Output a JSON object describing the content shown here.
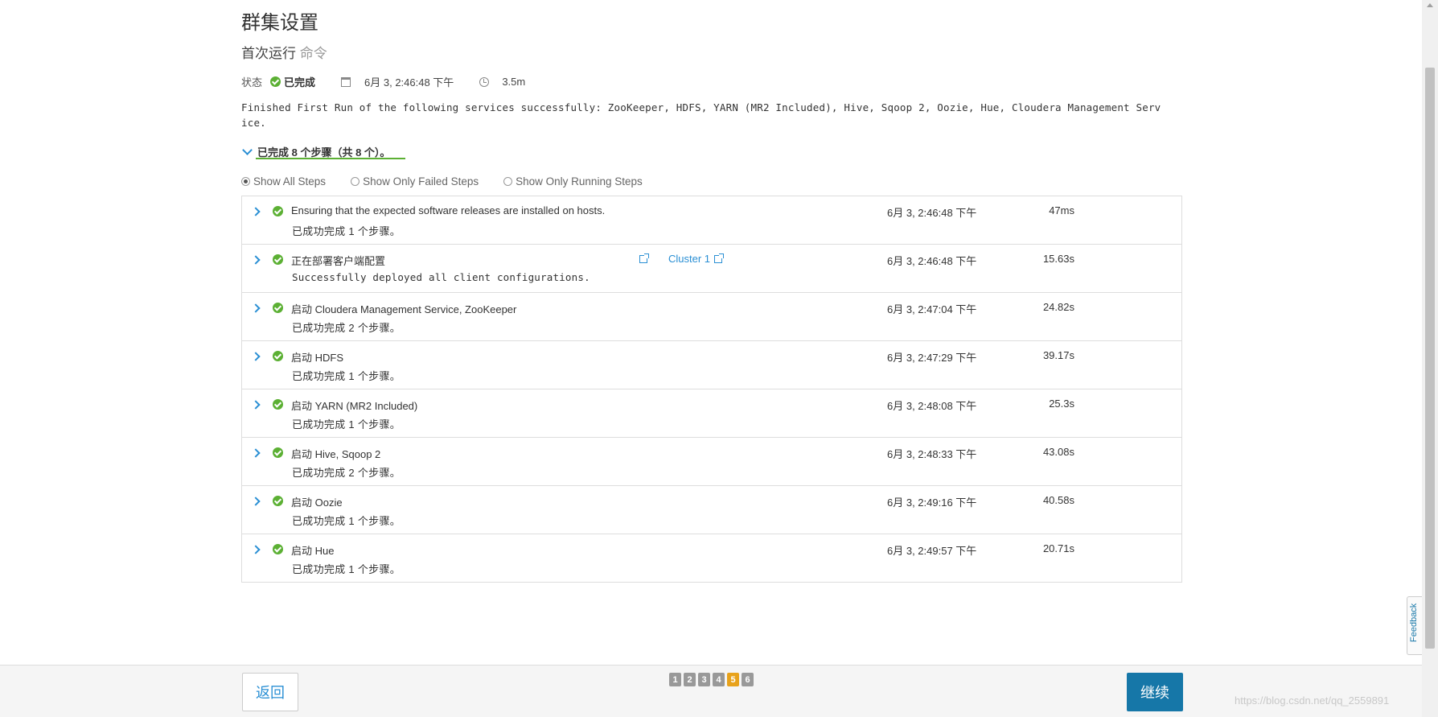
{
  "header": {
    "title": "群集设置",
    "subtitle_main": "首次运行",
    "subtitle_muted": "命令"
  },
  "status": {
    "label": "状态",
    "value": "已完成",
    "date": "6月 3, 2:46:48 下午",
    "duration": "3.5m"
  },
  "message": "Finished First Run of the following services successfully: ZooKeeper, HDFS, YARN (MR2 Included), Hive, Sqoop 2, Oozie, Hue, Cloudera Management Service.",
  "steps_summary": "已完成 8 个步骤（共 8 个）。",
  "filters": [
    {
      "label": "Show All Steps",
      "checked": true
    },
    {
      "label": "Show Only Failed Steps",
      "checked": false
    },
    {
      "label": "Show Only Running Steps",
      "checked": false
    }
  ],
  "steps": [
    {
      "name": "Ensuring that the expected software releases are installed on hosts.",
      "detail": "已成功完成 1 个步骤。",
      "time": "6月 3, 2:46:48 下午",
      "duration": "47ms"
    },
    {
      "name": "正在部署客户端配置",
      "detail": "Successfully deployed all client configurations.",
      "time": "6月 3, 2:46:48 下午",
      "duration": "15.63s",
      "cluster": "Cluster 1"
    },
    {
      "name": "启动 Cloudera Management Service, ZooKeeper",
      "detail": "已成功完成 2 个步骤。",
      "time": "6月 3, 2:47:04 下午",
      "duration": "24.82s"
    },
    {
      "name": "启动 HDFS",
      "detail": "已成功完成 1 个步骤。",
      "time": "6月 3, 2:47:29 下午",
      "duration": "39.17s"
    },
    {
      "name": "启动 YARN (MR2 Included)",
      "detail": "已成功完成 1 个步骤。",
      "time": "6月 3, 2:48:08 下午",
      "duration": "25.3s"
    },
    {
      "name": "启动 Hive, Sqoop 2",
      "detail": "已成功完成 2 个步骤。",
      "time": "6月 3, 2:48:33 下午",
      "duration": "43.08s"
    },
    {
      "name": "启动 Oozie",
      "detail": "已成功完成 1 个步骤。",
      "time": "6月 3, 2:49:16 下午",
      "duration": "40.58s"
    },
    {
      "name": "启动 Hue",
      "detail": "已成功完成 1 个步骤。",
      "time": "6月 3, 2:49:57 下午",
      "duration": "20.71s"
    }
  ],
  "footer": {
    "back_label": "返回",
    "continue_label": "继续",
    "pages": [
      "1",
      "2",
      "3",
      "4",
      "5",
      "6"
    ],
    "active_page": "5"
  },
  "feedback_label": "Feedback",
  "watermark": "https://blog.csdn.net/qq_2559891",
  "colors": {
    "success": "#5cb034",
    "link": "#2a8fd4",
    "primary_button": "#1677a8",
    "active_page": "#e8a21b"
  }
}
